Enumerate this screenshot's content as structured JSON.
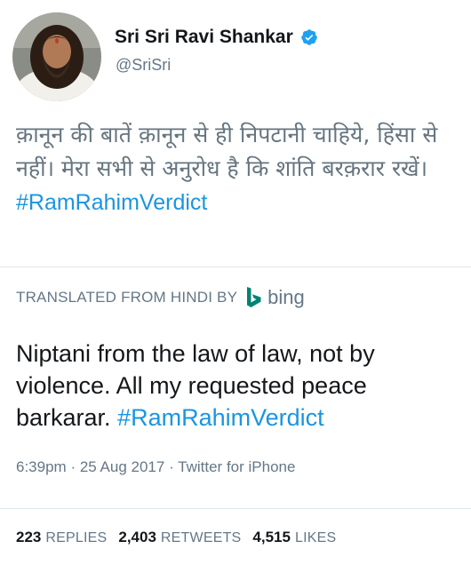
{
  "user": {
    "name": "Sri Sri Ravi Shankar",
    "handle": "@SriSri",
    "verified": true
  },
  "tweet": {
    "original_text": "क़ानून की बातें क़ानून से ही निपटानी चाहिये, हिंसा से नहीं। मेरा सभी से अनुरोध है कि शांति बरक़रार रखें।",
    "original_hashtag": "#RamRahimVerdict",
    "translated_label": "TRANSLATED FROM HINDI BY",
    "translator": "bing",
    "translated_text": "Niptani from the law of law, not by violence. All my requested peace barkarar.",
    "translated_hashtag": "#RamRahimVerdict",
    "time": "6:39pm",
    "sep1": "·",
    "date": "25 Aug 2017",
    "sep2": "·",
    "client": "Twitter for iPhone"
  },
  "stats": {
    "replies_count": "223",
    "replies_label": "REPLIES",
    "retweets_count": "2,403",
    "retweets_label": "RETWEETS",
    "likes_count": "4,515",
    "likes_label": "LIKES"
  },
  "colors": {
    "link": "#1b95e0",
    "secondary": "#657786",
    "verified": "#1da1f2",
    "bing": "#008373"
  },
  "icons": {
    "verified": "verified-badge-icon",
    "bing": "bing-logo-icon"
  }
}
